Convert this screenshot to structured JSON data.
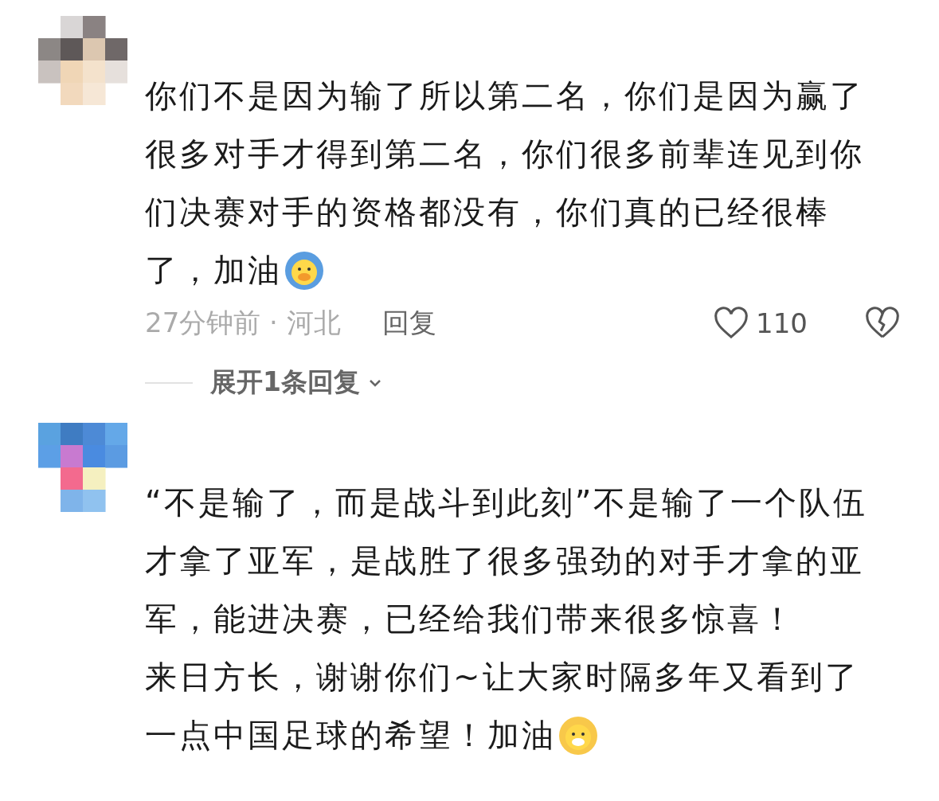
{
  "comments": [
    {
      "lines": [
        "你们不是因为输了所以第二名，你们是因为赢了",
        "很多对手才得到第二名，你们很多前辈连见到你",
        "们决赛对手的资格都没有，你们真的已经很棒",
        "了，加油"
      ],
      "time_location": "27分钟前 · 河北",
      "reply": "回复",
      "likes": "110",
      "liked": false,
      "expand_replies": "展开1条回复"
    },
    {
      "lines": [
        "“不是输了，而是战斗到此刻”不是输了一个队伍",
        "才拿了亚军，是战胜了很多强劲的对手才拿的亚",
        "军，能进决赛，已经给我们带来很多惊喜！",
        "来日方长，谢谢你们~让大家时隔多年又看到了",
        "一点中国足球的希望！加油"
      ]
    }
  ]
}
